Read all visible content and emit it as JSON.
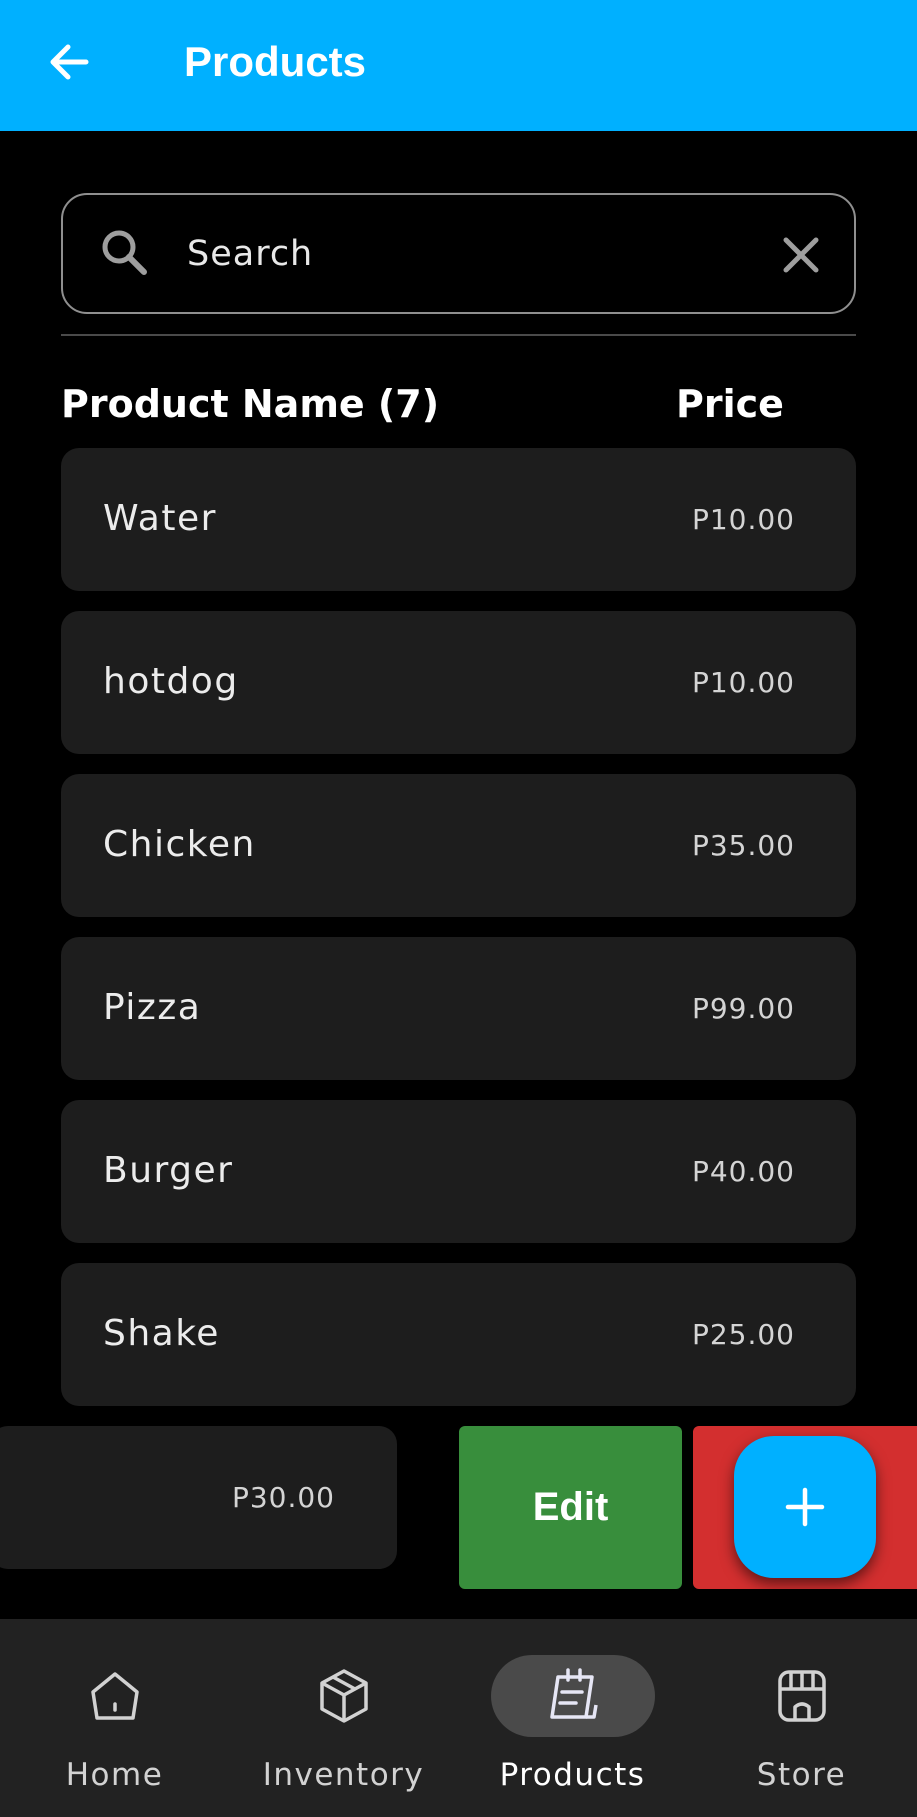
{
  "app_bar": {
    "title": "Products"
  },
  "search": {
    "placeholder": "Search"
  },
  "list_header": {
    "name_column": "Product Name (7)",
    "price_column": "Price"
  },
  "products": [
    {
      "name": "Water",
      "price": "P10.00"
    },
    {
      "name": "hotdog",
      "price": "P10.00"
    },
    {
      "name": "Chicken",
      "price": "P35.00"
    },
    {
      "name": "Pizza",
      "price": "P99.00"
    },
    {
      "name": "Burger",
      "price": "P40.00"
    },
    {
      "name": "Shake",
      "price": "P25.00"
    },
    {
      "name": "",
      "price": "P30.00"
    }
  ],
  "swipe_actions": {
    "edit_label": "Edit"
  },
  "bottom_nav": {
    "active": "Products",
    "items": [
      {
        "label": "Home",
        "icon": "home-icon"
      },
      {
        "label": "Inventory",
        "icon": "box-icon"
      },
      {
        "label": "Products",
        "icon": "notepad-icon"
      },
      {
        "label": "Store",
        "icon": "store-icon"
      }
    ]
  },
  "colors": {
    "app_bar": "#00b0ff",
    "background": "#000000",
    "card": "#1d1d1d",
    "edit": "#388e3c",
    "delete": "#d32f2f",
    "fab": "#00b0ff",
    "nav_bar": "#222222"
  }
}
